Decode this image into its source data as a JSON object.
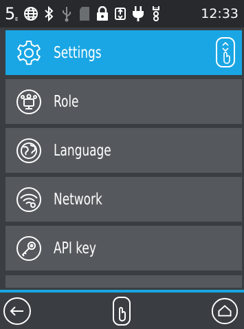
{
  "status_bar": {
    "time": "12:33",
    "icons": [
      "signal-level-icon",
      "globe-icon",
      "bluetooth-icon",
      "usb-icon",
      "sd-card-icon",
      "lock-icon",
      "sync-icon",
      "plug-icon",
      "usb-device-icon"
    ]
  },
  "menu": {
    "items": [
      {
        "label": "Settings",
        "icon": "gear-icon",
        "active": true
      },
      {
        "label": "Role",
        "icon": "role-icon",
        "active": false
      },
      {
        "label": "Language",
        "icon": "language-globe-icon",
        "active": false
      },
      {
        "label": "Network",
        "icon": "network-wifi-icon",
        "active": false
      },
      {
        "label": "API key",
        "icon": "key-icon",
        "active": false
      }
    ]
  },
  "nav": {
    "buttons": [
      "back-arrow-icon",
      "touch-gesture-icon",
      "home-icon"
    ]
  },
  "colors": {
    "accent": "#1aa6e4",
    "item_bg": "#55595d",
    "page_bg": "#3a3e42",
    "status_bg": "#27292c"
  }
}
